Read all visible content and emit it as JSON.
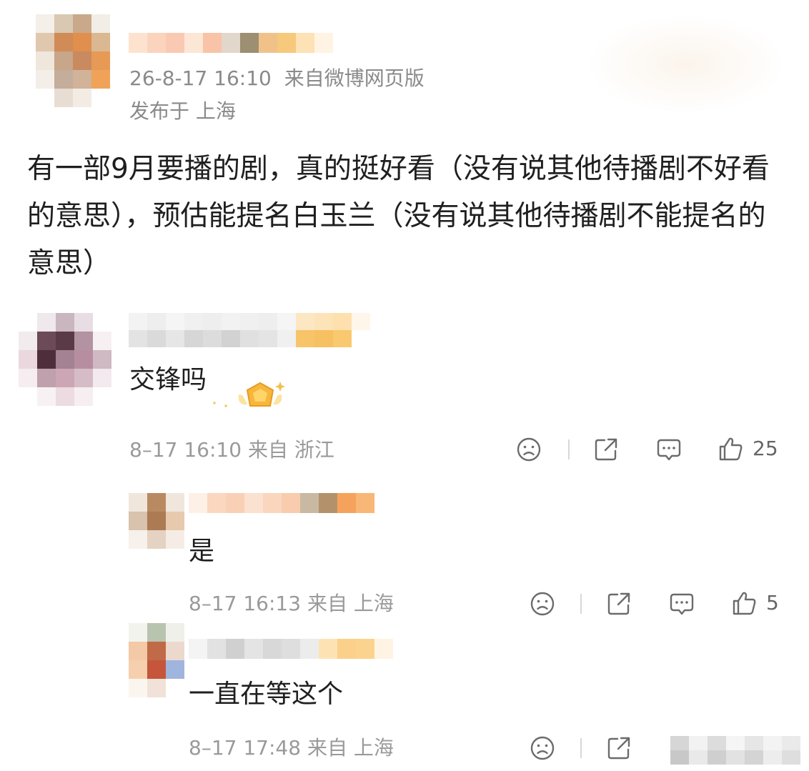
{
  "post": {
    "time": "26-8-17 16:10",
    "source": "来自微博网页版",
    "location": "发布于 上海",
    "body": "有一部9月要播的剧，真的挺好看（没有说其他待播剧不好看的意思），预估能提名白玉兰（没有说其他待播剧不能提名的意思）"
  },
  "comments": [
    {
      "text": "交锋吗",
      "time": "8–17 16:10",
      "from": "来自 浙江",
      "likes": "25"
    }
  ],
  "replies": [
    {
      "text": "是",
      "time": "8–17 16:13",
      "from": "来自 上海",
      "likes": "5"
    },
    {
      "text": "一直在等这个",
      "time": "8–17 17:48",
      "from": "来自 上海",
      "likes": ""
    }
  ],
  "icons": {
    "dislike": "sad-face-icon",
    "share": "share-icon",
    "reply": "comment-icon",
    "like": "thumbs-up-icon"
  },
  "colors": {
    "meta": "#8a8a8a",
    "body": "#1f1f1f",
    "icon": "#6b6b6b"
  }
}
